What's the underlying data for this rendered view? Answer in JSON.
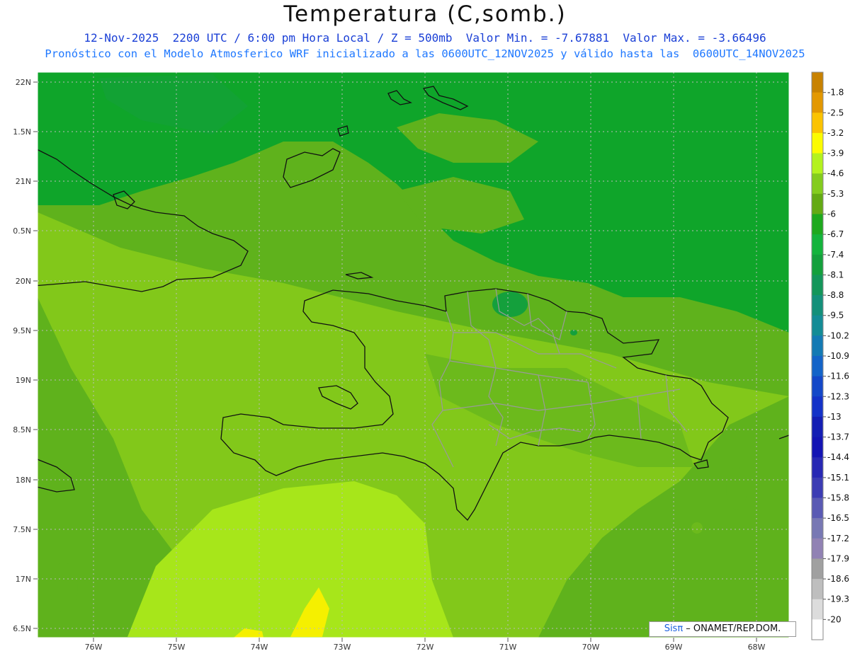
{
  "title": "Temperatura (C,somb.)",
  "subtitle_line1": "12-Nov-2025  2200 UTC / 6:00 pm Hora Local / Z = 500mb  Valor Min. = -7.67881  Valor Max. = -3.66496",
  "subtitle_line2": "Pronóstico con el Modelo Atmosferico WRF inicializado a las 0600UTC_12NOV2025 y válido hasta las  0600UTC_14NOV2025",
  "credit": {
    "brand": "Sisπ",
    "text": " – ONAMET/REP.DOM."
  },
  "map": {
    "lat_labels": [
      "22N",
      "1.5N",
      "21N",
      "0.5N",
      "20N",
      "9.5N",
      "19N",
      "8.5N",
      "18N",
      "7.5N",
      "17N",
      "6.5N"
    ],
    "lon_labels": [
      "76W",
      "75W",
      "74W",
      "73W",
      "72W",
      "71W",
      "70W",
      "69W",
      "68W"
    ],
    "field_colors": {
      "dark_green": "#0fa52a",
      "mid_green": "#5fb21c",
      "light_green": "#82c81a",
      "yellow_green": "#a7e61a",
      "yellow": "#f5f000"
    }
  },
  "colorbar": {
    "labels": [
      "-1.8",
      "-2.5",
      "-3.2",
      "-3.9",
      "-4.6",
      "-5.3",
      "-6",
      "-6.7",
      "-7.4",
      "-8.1",
      "-8.8",
      "-9.5",
      "-10.2",
      "-10.9",
      "-11.6",
      "-12.3",
      "-13",
      "-13.7",
      "-14.4",
      "-15.1",
      "-15.8",
      "-16.5",
      "-17.2",
      "-17.9",
      "-18.6",
      "-19.3",
      "-20"
    ],
    "colors": [
      "#c88200",
      "#e39800",
      "#fbc300",
      "#fbfb00",
      "#b4f21e",
      "#84cc1e",
      "#64aa14",
      "#1ea91e",
      "#14b43c",
      "#14a03c",
      "#14965a",
      "#14907a",
      "#148c96",
      "#147ab4",
      "#1464c8",
      "#1448c8",
      "#1432c8",
      "#141eb4",
      "#1414b4",
      "#2828b4",
      "#3c3cb4",
      "#5a5ab4",
      "#7878b4",
      "#9182b4",
      "#a0a0a0",
      "#bebebe",
      "#dcdcdc",
      "#ffffff"
    ]
  }
}
